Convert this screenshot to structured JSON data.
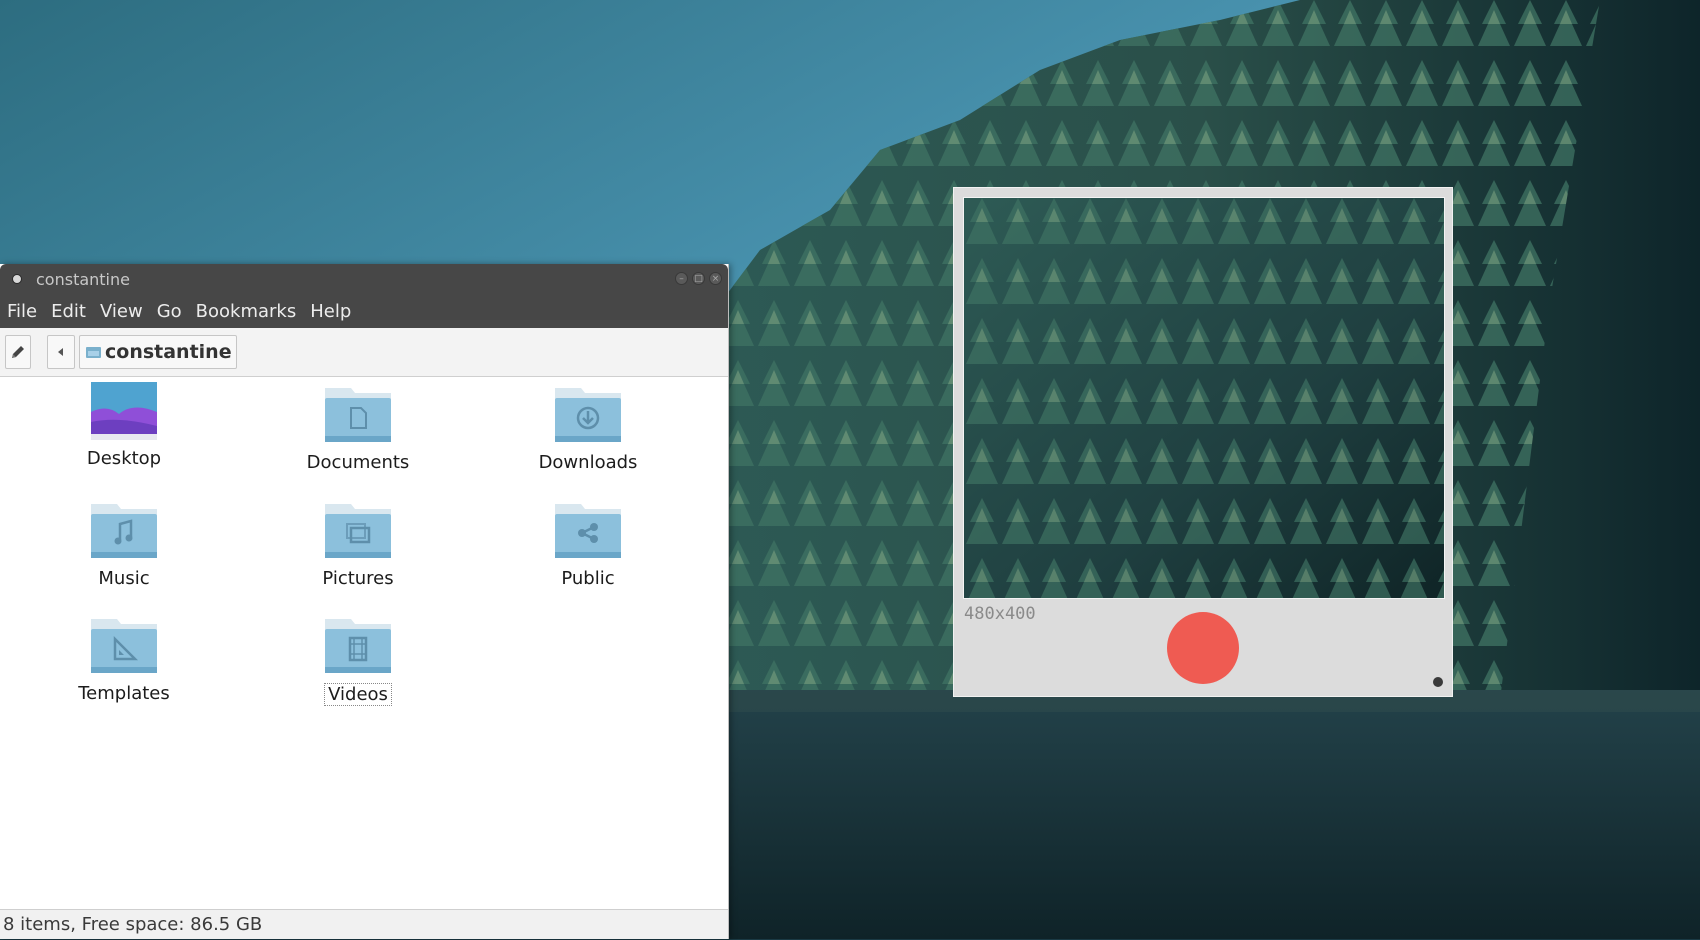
{
  "file_manager": {
    "title": "constantine",
    "menu": [
      "File",
      "Edit",
      "View",
      "Go",
      "Bookmarks",
      "Help"
    ],
    "path_button": "constantine",
    "items": [
      {
        "name": "Desktop",
        "icon": "desktop-image-icon"
      },
      {
        "name": "Documents",
        "icon": "document-icon"
      },
      {
        "name": "Downloads",
        "icon": "download-icon"
      },
      {
        "name": "Music",
        "icon": "music-note-icon"
      },
      {
        "name": "Pictures",
        "icon": "picture-icon"
      },
      {
        "name": "Public",
        "icon": "share-icon"
      },
      {
        "name": "Templates",
        "icon": "set-square-icon"
      },
      {
        "name": "Videos",
        "icon": "film-icon"
      }
    ],
    "selected_item": "Videos",
    "status": "8 items, Free space: 86.5 GB"
  },
  "recorder": {
    "size_label": "480x400",
    "record_color": "#ef5b52"
  },
  "colors": {
    "titlebar": "#474747",
    "folder": "#7ab0cc"
  }
}
